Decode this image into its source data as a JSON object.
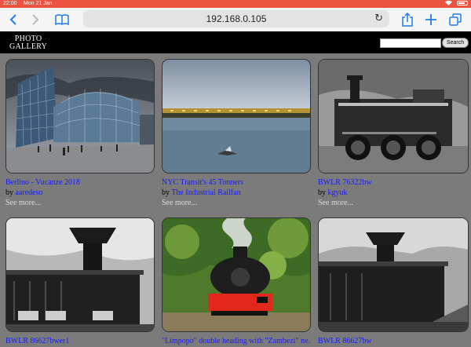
{
  "status": {
    "time": "22:00",
    "date": "Mon 21 Jan"
  },
  "browser": {
    "url": "192.168.0.105"
  },
  "site": {
    "logo_line1": "PHOTO",
    "logo_line2": "GALLERY",
    "search_placeholder": "",
    "search_button": "Search"
  },
  "photos": [
    {
      "title": "Berlino - Vucanze 2018",
      "by": "by",
      "author": "aaredeso",
      "more": "See more..."
    },
    {
      "title": "NYC Transit's 45 Tonners",
      "by": "by",
      "author": "The Industrial Railfan",
      "more": "See more..."
    },
    {
      "title": "BWLR 76322bw",
      "by": "by",
      "author": "kgyuk",
      "more": "See more..."
    },
    {
      "title": "BWLR 86627bwer1",
      "by": "",
      "author": "",
      "more": ""
    },
    {
      "title": "\"Limpopo\" double heading with \"Zambezi\" ne...",
      "by": "",
      "author": "",
      "more": ""
    },
    {
      "title": "BWLR 86627bw",
      "by": "",
      "author": "",
      "more": ""
    }
  ],
  "icons": {
    "back": "chevron-left-icon",
    "forward": "chevron-right-icon",
    "bookmarks": "book-icon",
    "reload": "reload-icon",
    "share": "share-icon",
    "new_tab": "plus-icon",
    "tabs": "tabs-icon"
  },
  "colors": {
    "status_bar": "#e9533f",
    "link": "#1a1aff",
    "page_bg": "#7b7b7b",
    "header": "#000000"
  }
}
